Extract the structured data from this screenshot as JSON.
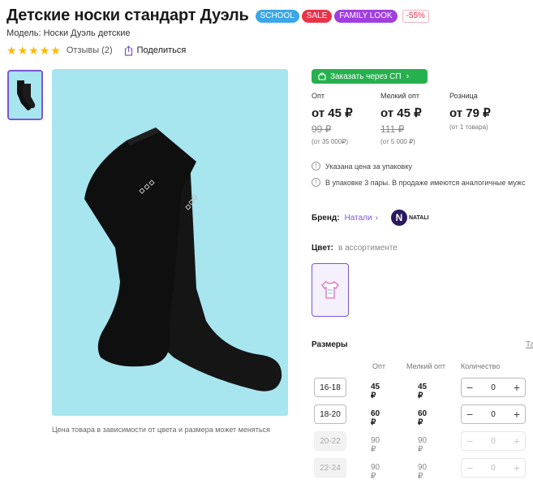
{
  "product": {
    "title": "Детские носки стандарт Дуэль",
    "badges": [
      {
        "label": "SCHOOL",
        "color": "#3aa7e8"
      },
      {
        "label": "SALE",
        "color": "#e8334a"
      },
      {
        "label": "FAMILY LOOK",
        "color": "#a13ee0"
      }
    ],
    "discount": "-55%",
    "model": "Модель: Носки Дуэль детские",
    "rating_stars": 5,
    "reviews": "Отзывы (2)",
    "share": "Поделиться"
  },
  "gallery": {
    "caption": "Цена товара в зависимости от цвета и размера может меняться"
  },
  "purchase": {
    "sp_button": "Заказать через СП",
    "prices": [
      {
        "label": "Опт",
        "price": "от 45 ₽",
        "old": "99 ₽",
        "note": "(от 35 000₽)"
      },
      {
        "label": "Мелкий опт",
        "price": "от 45 ₽",
        "old": "111 ₽",
        "note": "(от 5 000 ₽)"
      },
      {
        "label": "Розница",
        "price": "от 79 ₽",
        "old": "",
        "note": "(от 1 товара)"
      }
    ],
    "info": [
      "Указана цена за упаковку",
      "В упаковке 3 пары. В продаже имеются аналогичные мужс"
    ],
    "brand_label": "Бренд:",
    "brand_name": "Натали",
    "brand_logo_letter": "N",
    "brand_logo_text": "NATALI",
    "color_label": "Цвет:",
    "color_value": "в ассортименте"
  },
  "sizes": {
    "title": "Размеры",
    "tab": "Та",
    "headers": [
      "Опт",
      "Мелкий опт",
      "Количество"
    ],
    "rows": [
      {
        "size": "16-18",
        "opt": "45 ₽",
        "small": "45 ₽",
        "qty": "0",
        "disabled": false
      },
      {
        "size": "18-20",
        "opt": "60 ₽",
        "small": "60 ₽",
        "qty": "0",
        "disabled": false
      },
      {
        "size": "20-22",
        "opt": "90 ₽",
        "small": "90 ₽",
        "qty": "0",
        "disabled": true
      },
      {
        "size": "22-24",
        "opt": "90 ₽",
        "small": "90 ₽",
        "qty": "0",
        "disabled": true
      }
    ]
  },
  "colors": {
    "accent": "#7b57d6",
    "green": "#27b04f",
    "image_bg": "#a7e5ef"
  }
}
